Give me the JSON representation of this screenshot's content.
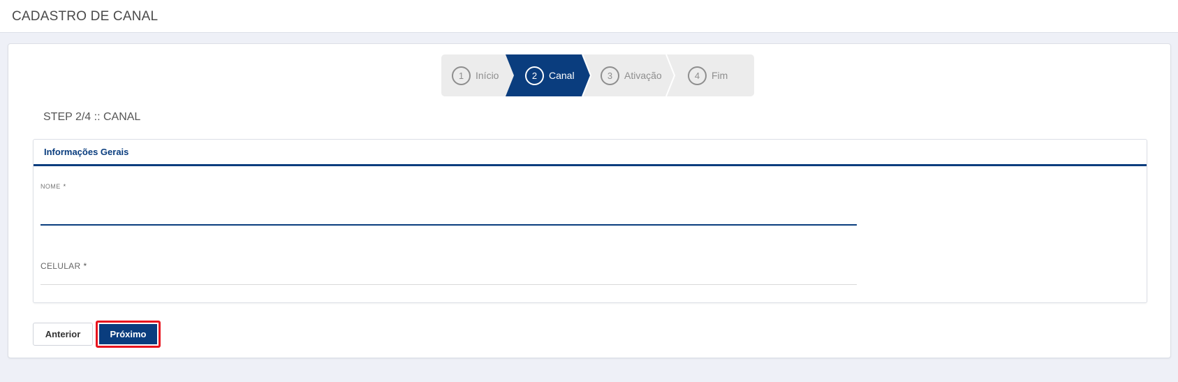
{
  "header": {
    "title": "CADASTRO DE CANAL"
  },
  "stepper": {
    "steps": [
      {
        "number": "1",
        "label": "Início"
      },
      {
        "number": "2",
        "label": "Canal"
      },
      {
        "number": "3",
        "label": "Ativação"
      },
      {
        "number": "4",
        "label": "Fim"
      }
    ],
    "active_step": 2,
    "active_color": "#0a3d7e",
    "inactive_color": "#ececec"
  },
  "main": {
    "step_heading": "STEP 2/4 :: CANAL",
    "panel": {
      "title": "Informações Gerais",
      "fields": {
        "nome": {
          "label": "NOME",
          "required": "*",
          "value": ""
        },
        "celular": {
          "label": "CELULAR",
          "required": "*",
          "value": ""
        }
      }
    }
  },
  "actions": {
    "prev_label": "Anterior",
    "next_label": "Próximo",
    "highlight_color": "#e8141e"
  }
}
